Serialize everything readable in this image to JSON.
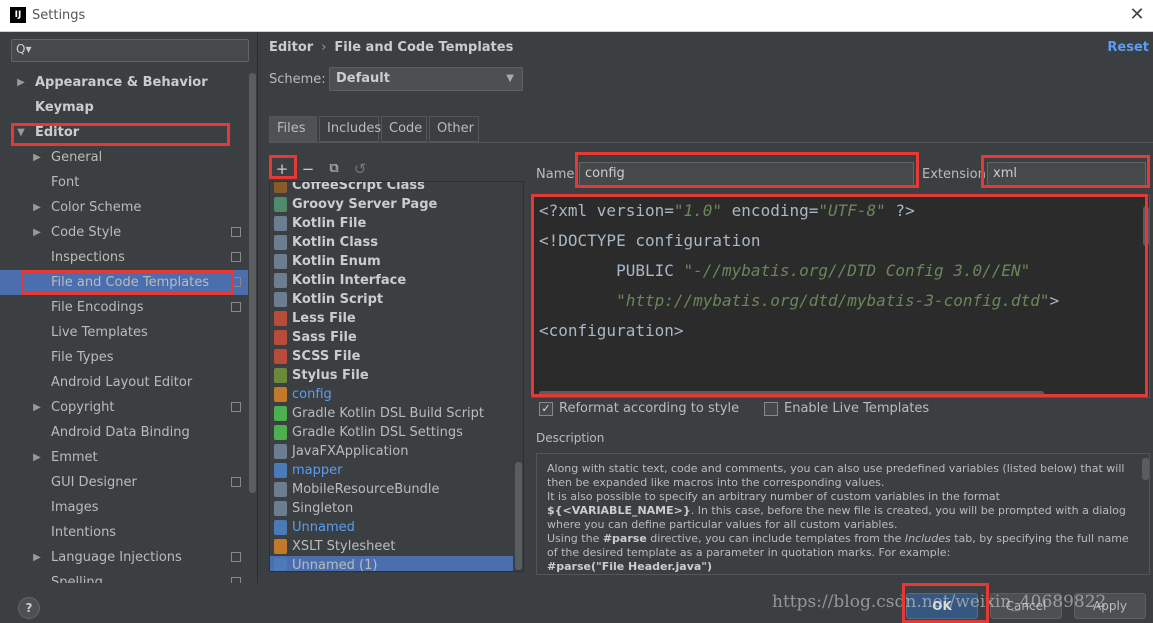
{
  "window": {
    "title": "Settings",
    "logo": "IJ"
  },
  "search": {
    "icon": "search-icon",
    "glyph": "Q▾",
    "value": ""
  },
  "sidebar": {
    "items": [
      {
        "label": "Appearance & Behavior",
        "level": 0,
        "arrow": "▶",
        "bold": true
      },
      {
        "label": "Keymap",
        "level": 0,
        "arrow": "",
        "bold": true
      },
      {
        "label": "Editor",
        "level": 0,
        "arrow": "▼",
        "bold": true
      },
      {
        "label": "General",
        "level": 1,
        "arrow": "▶"
      },
      {
        "label": "Font",
        "level": 1,
        "arrow": ""
      },
      {
        "label": "Color Scheme",
        "level": 1,
        "arrow": "▶"
      },
      {
        "label": "Code Style",
        "level": 1,
        "arrow": "▶",
        "copy": true
      },
      {
        "label": "Inspections",
        "level": 1,
        "arrow": "",
        "copy": true
      },
      {
        "label": "File and Code Templates",
        "level": 1,
        "arrow": "",
        "copy": true,
        "selected": true
      },
      {
        "label": "File Encodings",
        "level": 1,
        "arrow": "",
        "copy": true
      },
      {
        "label": "Live Templates",
        "level": 1,
        "arrow": ""
      },
      {
        "label": "File Types",
        "level": 1,
        "arrow": ""
      },
      {
        "label": "Android Layout Editor",
        "level": 1,
        "arrow": ""
      },
      {
        "label": "Copyright",
        "level": 1,
        "arrow": "▶",
        "copy": true
      },
      {
        "label": "Android Data Binding",
        "level": 1,
        "arrow": ""
      },
      {
        "label": "Emmet",
        "level": 1,
        "arrow": "▶"
      },
      {
        "label": "GUI Designer",
        "level": 1,
        "arrow": "",
        "copy": true
      },
      {
        "label": "Images",
        "level": 1,
        "arrow": ""
      },
      {
        "label": "Intentions",
        "level": 1,
        "arrow": ""
      },
      {
        "label": "Language Injections",
        "level": 1,
        "arrow": "▶",
        "copy": true
      },
      {
        "label": "Spelling",
        "level": 1,
        "arrow": "",
        "copy": true
      }
    ]
  },
  "header": {
    "breadcrumb_root": "Editor",
    "breadcrumb_sep": "›",
    "breadcrumb_page": "File and Code Templates",
    "reset": "Reset"
  },
  "scheme": {
    "label": "Scheme:",
    "value": "Default"
  },
  "tabs": [
    "Files",
    "Includes",
    "Code",
    "Other"
  ],
  "toolbar": {
    "add": "+",
    "remove": "−",
    "copy": "⧉",
    "revert": "↺"
  },
  "templates": [
    {
      "name": "CoffeeScript Class",
      "bold": true,
      "color": "#8b5a2b"
    },
    {
      "name": "Groovy Server Page",
      "bold": true,
      "color": "#4e8a6b"
    },
    {
      "name": "Kotlin File",
      "bold": true,
      "color": "#6b7d8f"
    },
    {
      "name": "Kotlin Class",
      "bold": true,
      "color": "#6b7d8f"
    },
    {
      "name": "Kotlin Enum",
      "bold": true,
      "color": "#6b7d8f"
    },
    {
      "name": "Kotlin Interface",
      "bold": true,
      "color": "#6b7d8f"
    },
    {
      "name": "Kotlin Script",
      "bold": true,
      "color": "#6b7d8f"
    },
    {
      "name": "Less File",
      "bold": true,
      "color": "#b84c3a"
    },
    {
      "name": "Sass File",
      "bold": true,
      "color": "#b84c3a"
    },
    {
      "name": "SCSS File",
      "bold": true,
      "color": "#b84c3a"
    },
    {
      "name": "Stylus File",
      "bold": true,
      "color": "#6a8a3a"
    },
    {
      "name": "config",
      "blue": true,
      "color": "#c07a2a"
    },
    {
      "name": "Gradle Kotlin DSL Build Script",
      "color": "#4caf50"
    },
    {
      "name": "Gradle Kotlin DSL Settings",
      "color": "#4caf50"
    },
    {
      "name": "JavaFXApplication",
      "color": "#6b7d8f"
    },
    {
      "name": "mapper",
      "blue": true,
      "color": "#4a7ab8"
    },
    {
      "name": "MobileResourceBundle",
      "color": "#6b7d8f"
    },
    {
      "name": "Singleton",
      "color": "#6b7d8f"
    },
    {
      "name": "Unnamed",
      "blue": true,
      "color": "#4a7ab8"
    },
    {
      "name": "XSLT Stylesheet",
      "color": "#c07a2a"
    },
    {
      "name": "Unnamed (1)",
      "color": "#4a7ab8",
      "selected": true
    }
  ],
  "form": {
    "name_label": "Name:",
    "name_value": "config",
    "ext_label": "Extension:",
    "ext_value": "xml"
  },
  "code_lines": [
    [
      {
        "t": "<?xml version="
      },
      {
        "t": "\"1.0\"",
        "s": true
      },
      {
        "t": " encoding="
      },
      {
        "t": "\"UTF-8\"",
        "s": true
      },
      {
        "t": " ?>"
      }
    ],
    [
      {
        "t": "<!DOCTYPE configuration"
      }
    ],
    [
      {
        "t": "        PUBLIC "
      },
      {
        "t": "\"-//mybatis.org//DTD Config 3.0//EN\"",
        "s": true
      }
    ],
    [
      {
        "t": "        "
      },
      {
        "t": "\"http://mybatis.org/dtd/mybatis-3-config.dtd\"",
        "s": true
      },
      {
        "t": ">"
      }
    ],
    [
      {
        "t": "<configuration>"
      }
    ]
  ],
  "options": {
    "reformat": "Reformat according to style",
    "reformat_checked": true,
    "live": "Enable Live Templates",
    "live_checked": false
  },
  "description": {
    "title": "Description",
    "p1": "Along with static text, code and comments, you can also use predefined variables (listed below) that will then be expanded like macros into the corresponding values.",
    "p2a": "It is also possible to specify an arbitrary number of custom variables in the format ",
    "p2b": "${<VARIABLE_NAME>}",
    "p2c": ". In this case, before the new file is created, you will be prompted with a dialog where you can define particular values for all custom variables.",
    "p3a": "Using the ",
    "p3b": "#parse",
    "p3c": " directive, you can include templates from the ",
    "p3d": "Includes",
    "p3e": " tab, by specifying the full name of the desired template as a parameter in quotation marks. For example:",
    "p4": "#parse(\"File Header.java\")"
  },
  "buttons": {
    "help": "?",
    "ok": "OK",
    "cancel": "Cancel",
    "apply": "Apply"
  },
  "watermark": "https://blog.csdn.net/weixin_40689822",
  "colors": {
    "accent": "#4b6eaf",
    "link": "#589df6",
    "highlight": "#e53935"
  }
}
